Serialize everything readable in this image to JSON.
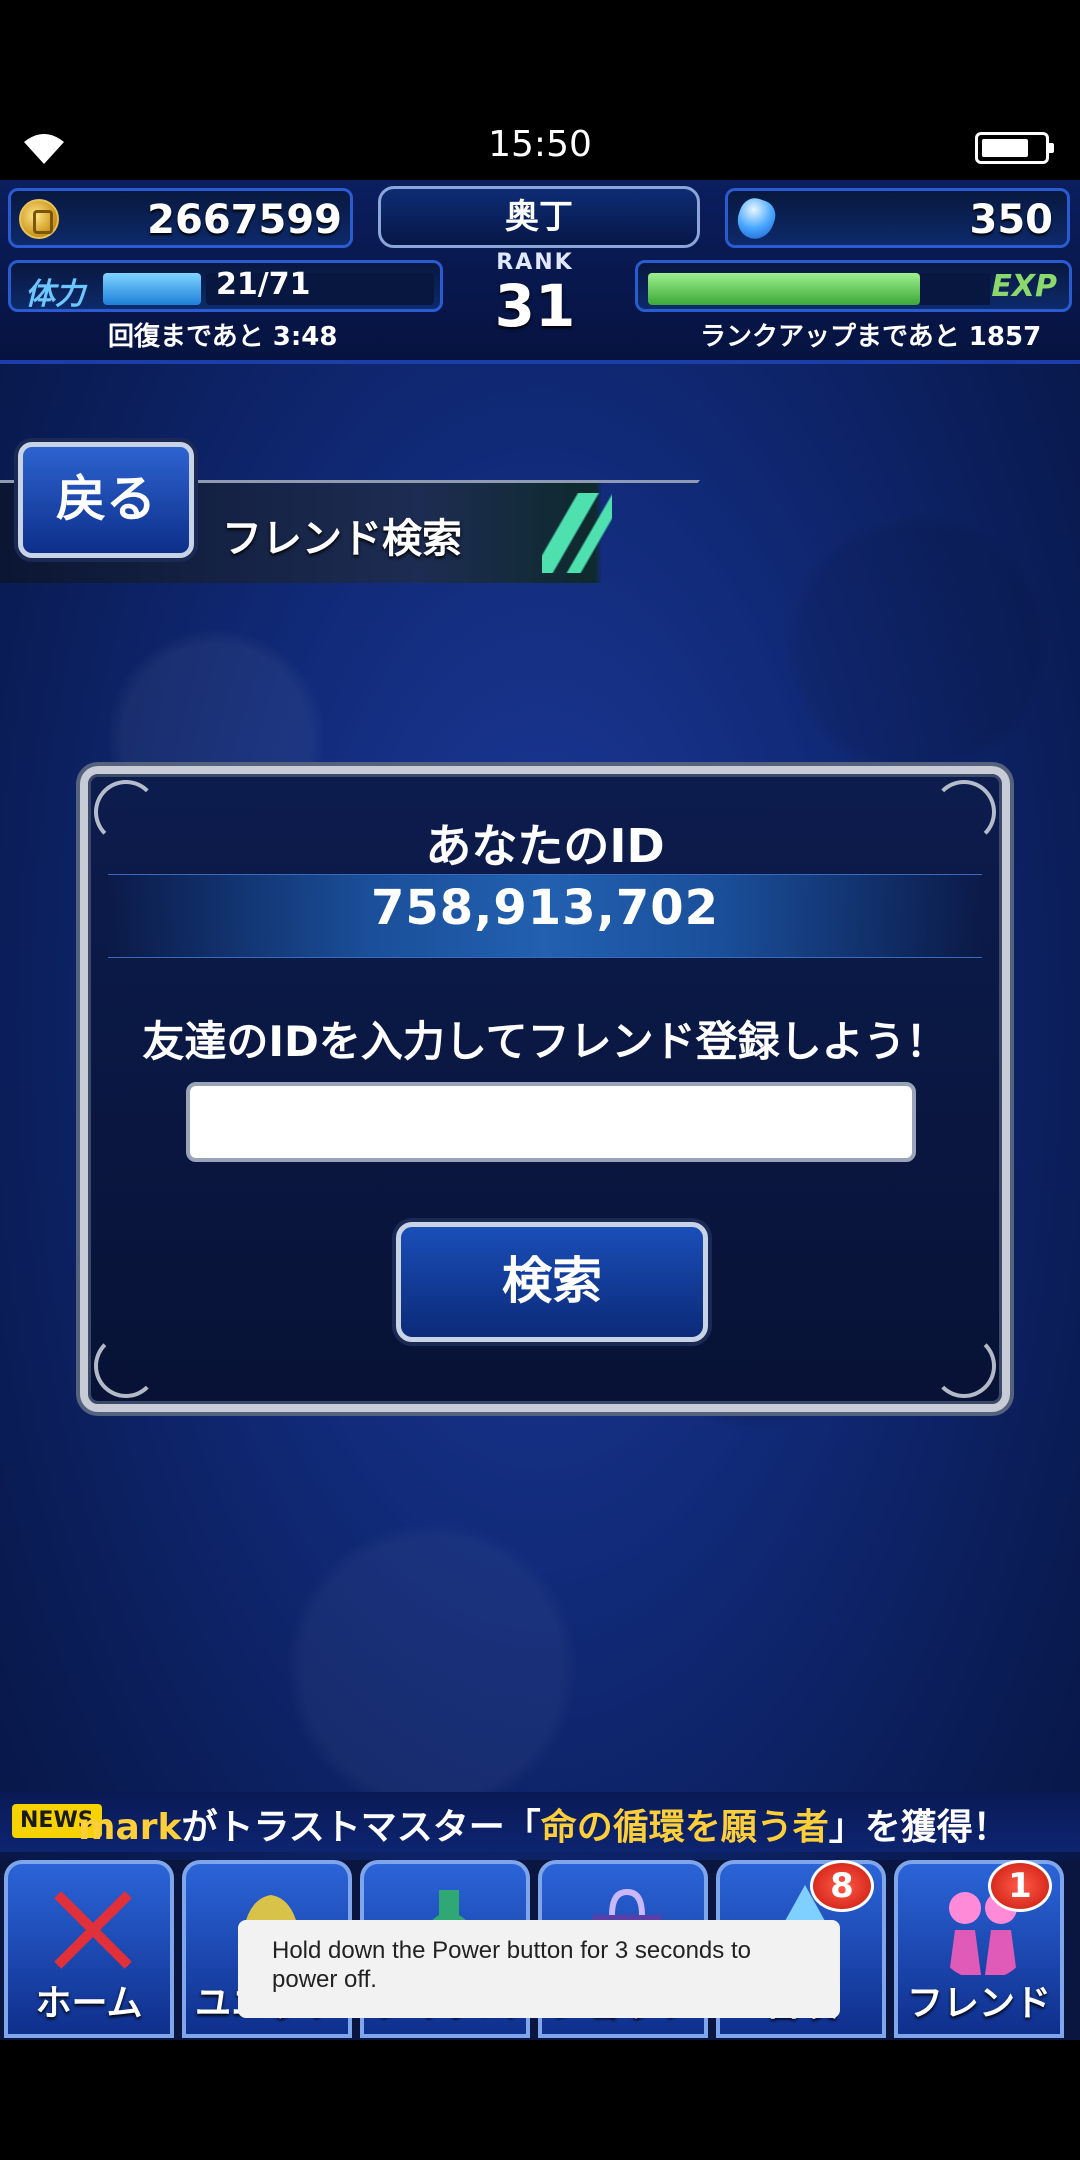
{
  "status_bar": {
    "time": "15:50"
  },
  "hud": {
    "gil": "2667599",
    "gems": "350",
    "player_name": "奥丁",
    "rank_label": "RANK",
    "rank": "31",
    "stamina_label": "体力",
    "stamina": "21/71",
    "stamina_fraction": 0.296,
    "recover_text": "回復まであと 3:48",
    "exp_label": "EXP",
    "exp_fraction": 0.8,
    "rankup_text": "ランクアップまであと 1857"
  },
  "header": {
    "back_label": "戻る",
    "title": "フレンド検索"
  },
  "dialog": {
    "your_id_label": "あなたのID",
    "your_id_value": "758,913,702",
    "prompt": "友達のIDを入力してフレンド登録しよう！",
    "input_value": "",
    "search_label": "検索"
  },
  "news": {
    "badge": "NEWS",
    "player": "mark",
    "text_1": "がトラストマスター「",
    "highlight": "命の循環を願う者",
    "text_2": "」を獲得！"
  },
  "nav": [
    {
      "label": "ホーム",
      "badge": ""
    },
    {
      "label": "ユニット",
      "badge": ""
    },
    {
      "label": "アイテム",
      "badge": ""
    },
    {
      "label": "ショップ",
      "badge": ""
    },
    {
      "label": "召喚",
      "badge": "8"
    },
    {
      "label": "フレンド",
      "badge": "1"
    }
  ],
  "toast": {
    "text": "Hold down the Power button for 3 seconds to power off."
  }
}
